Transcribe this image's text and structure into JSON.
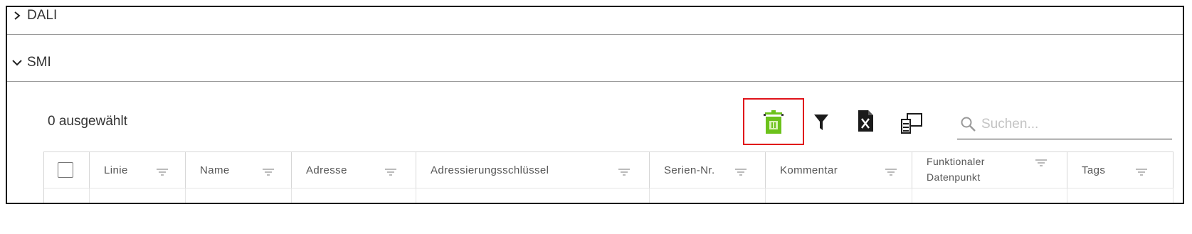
{
  "sections": {
    "dali": {
      "label": "DALI",
      "expanded": false
    },
    "smi": {
      "label": "SMI",
      "expanded": true
    }
  },
  "selection": {
    "count_text": "0 ausgewählt"
  },
  "toolbar": {
    "icons": [
      "bin-icon",
      "filter-icon",
      "excel-export-icon",
      "columns-icon"
    ],
    "accent_color": "#6cc21b",
    "highlight_color": "#e0131a"
  },
  "search": {
    "placeholder": "Suchen..."
  },
  "table": {
    "columns": [
      {
        "label": "Linie"
      },
      {
        "label": "Name"
      },
      {
        "label": "Adresse"
      },
      {
        "label": "Adressierungsschlüssel"
      },
      {
        "label": "Serien-Nr."
      },
      {
        "label": "Kommentar"
      },
      {
        "label_line1": "Funktionaler",
        "label_line2": "Datenpunkt"
      },
      {
        "label": "Tags"
      }
    ]
  }
}
